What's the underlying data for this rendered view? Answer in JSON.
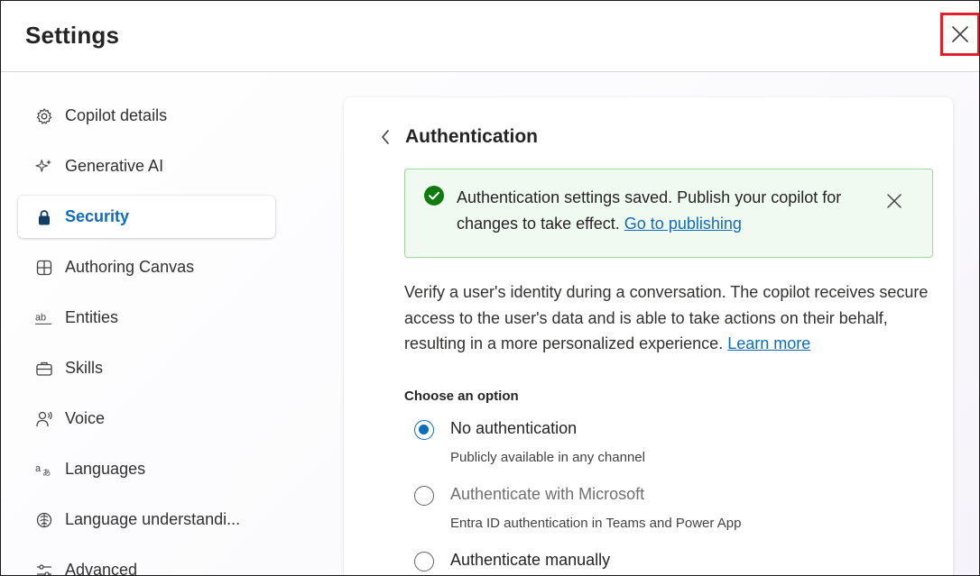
{
  "header": {
    "title": "Settings",
    "close_icon": "close-icon"
  },
  "sidebar": {
    "items": [
      {
        "label": "Copilot details",
        "icon": "gear-icon"
      },
      {
        "label": "Generative AI",
        "icon": "sparkle-icon"
      },
      {
        "label": "Security",
        "icon": "lock-icon",
        "active": true
      },
      {
        "label": "Authoring Canvas",
        "icon": "grid-icon"
      },
      {
        "label": "Entities",
        "icon": "text-ab-icon"
      },
      {
        "label": "Skills",
        "icon": "briefcase-icon"
      },
      {
        "label": "Voice",
        "icon": "person-voice-icon"
      },
      {
        "label": "Languages",
        "icon": "translate-icon"
      },
      {
        "label": "Language understandi...",
        "icon": "brain-icon"
      },
      {
        "label": "Advanced",
        "icon": "sliders-icon"
      }
    ]
  },
  "panel": {
    "title": "Authentication",
    "banner": {
      "text": "Authentication settings saved. Publish your copilot for changes to take effect. ",
      "link": "Go to publishing",
      "status_color": "#107c10"
    },
    "description": "Verify a user's identity during a conversation. The copilot receives secure access to the user's data and is able to take actions on their behalf, resulting in a more personalized experience. ",
    "description_link": "Learn more",
    "choose_label": "Choose an option",
    "options": [
      {
        "label": "No authentication",
        "sub": "Publicly available in any channel",
        "selected": true
      },
      {
        "label": "Authenticate with Microsoft",
        "sub": "Entra ID authentication in Teams and Power App",
        "selected": false
      },
      {
        "label": "Authenticate manually",
        "sub": "",
        "selected": false
      }
    ]
  },
  "colors": {
    "accent": "#0f6cbd",
    "success": "#107c10",
    "highlight": "#e0202a"
  }
}
